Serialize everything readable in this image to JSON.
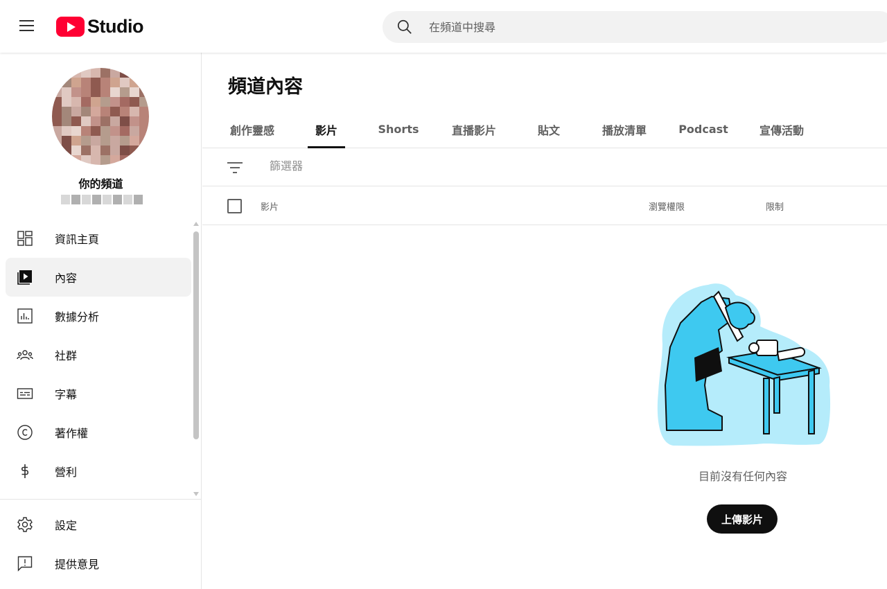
{
  "header": {
    "logo_text": "Studio",
    "search_placeholder": "在頻道中搜尋"
  },
  "sidebar": {
    "channel_label": "你的頻道",
    "items": [
      {
        "label": "資訊主頁",
        "icon": "dashboard-icon",
        "active": false
      },
      {
        "label": "內容",
        "icon": "content-icon",
        "active": true
      },
      {
        "label": "數據分析",
        "icon": "analytics-icon",
        "active": false
      },
      {
        "label": "社群",
        "icon": "community-icon",
        "active": false
      },
      {
        "label": "字幕",
        "icon": "subtitles-icon",
        "active": false
      },
      {
        "label": "著作權",
        "icon": "copyright-icon",
        "active": false
      },
      {
        "label": "營利",
        "icon": "monetization-icon",
        "active": false
      }
    ],
    "bottom_items": [
      {
        "label": "設定",
        "icon": "settings-icon"
      },
      {
        "label": "提供意見",
        "icon": "feedback-icon"
      }
    ]
  },
  "main": {
    "title": "頻道內容",
    "tabs": [
      {
        "label": "創作靈感",
        "active": false
      },
      {
        "label": "影片",
        "active": true
      },
      {
        "label": "Shorts",
        "active": false
      },
      {
        "label": "直播影片",
        "active": false
      },
      {
        "label": "貼文",
        "active": false
      },
      {
        "label": "播放清單",
        "active": false
      },
      {
        "label": "Podcast",
        "active": false
      },
      {
        "label": "宣傳活動",
        "active": false
      }
    ],
    "filter_placeholder": "篩選器",
    "columns": {
      "video": "影片",
      "visibility": "瀏覽權限",
      "restrictions": "限制"
    },
    "empty_message": "目前沒有任何內容",
    "upload_button": "上傳影片"
  },
  "colors": {
    "brand_red": "#ff0033",
    "illustration_blue": "#3ec9f0",
    "illustration_light": "#b5ecfb"
  }
}
